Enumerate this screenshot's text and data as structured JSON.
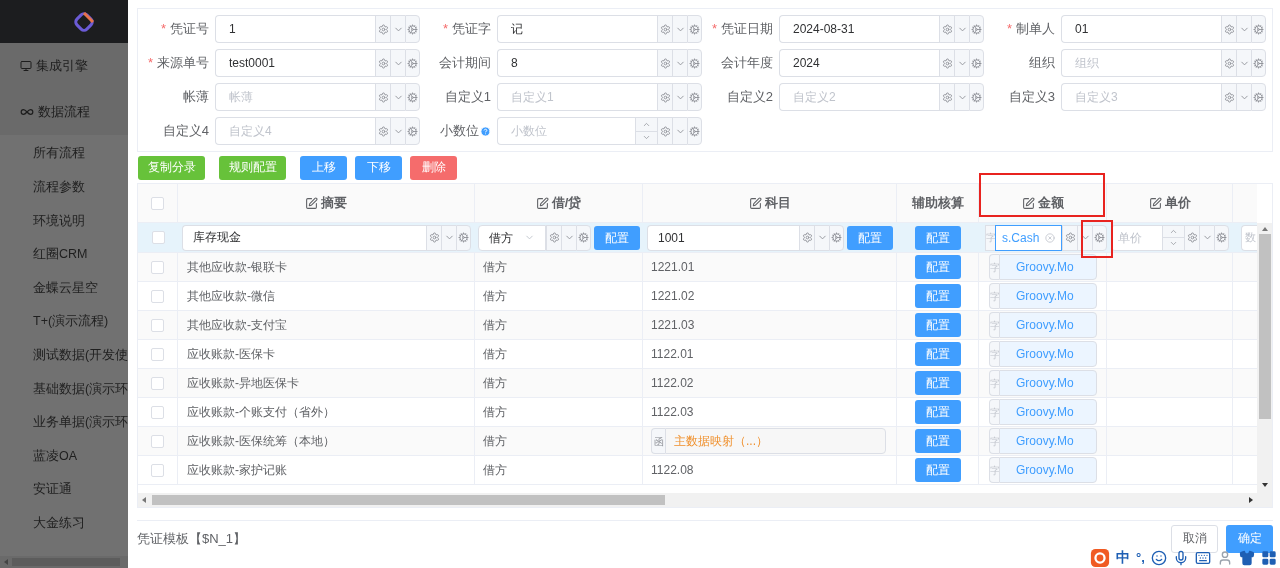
{
  "sidebar": {
    "sections": [
      {
        "label": "集成引擎",
        "kind": "engine"
      },
      {
        "label": "数据流程",
        "kind": "flow"
      }
    ],
    "items": [
      "所有流程",
      "流程参数",
      "环境说明",
      "红圈CRM",
      "金蝶云星空",
      "T+(演示流程)",
      "测试数据(开发使",
      "基础数据(演示环",
      "业务单据(演示环",
      "蓝凌OA",
      "安证通",
      "大金练习"
    ]
  },
  "form": {
    "fields": [
      {
        "mark": "*",
        "label": "凭证号",
        "value": "1",
        "kind": "text"
      },
      {
        "mark": "*",
        "label": "凭证字",
        "value": "记",
        "kind": "text"
      },
      {
        "mark": "*",
        "label": "凭证日期",
        "value": "2024-08-31",
        "kind": "text"
      },
      {
        "mark": "*",
        "label": "制单人",
        "value": "01",
        "kind": "text"
      },
      {
        "mark": "*",
        "label": "来源单号",
        "value": "test0001",
        "kind": "text"
      },
      {
        "label": "会计期间",
        "value": "8",
        "kind": "text"
      },
      {
        "label": "会计年度",
        "value": "2024",
        "kind": "text"
      },
      {
        "label": "组织",
        "placeholder": "组织",
        "kind": "text"
      },
      {
        "label": "帐薄",
        "placeholder": "帐薄",
        "kind": "text"
      },
      {
        "label": "自定义1",
        "placeholder": "自定义1",
        "kind": "text"
      },
      {
        "label": "自定义2",
        "placeholder": "自定义2",
        "kind": "text"
      },
      {
        "label": "自定义3",
        "placeholder": "自定义3",
        "kind": "text"
      },
      {
        "label": "自定义4",
        "placeholder": "自定义4",
        "kind": "text"
      },
      {
        "label": "小数位",
        "placeholder": "小数位",
        "kind": "number",
        "help": true
      }
    ]
  },
  "toolbar": [
    {
      "label": "复制分录",
      "kind": "success"
    },
    {
      "label": "规则配置",
      "kind": "success"
    },
    {
      "label": "上移",
      "kind": "primary"
    },
    {
      "label": "下移",
      "kind": "primary"
    },
    {
      "label": "删除",
      "kind": "danger"
    }
  ],
  "table": {
    "all_checked": false,
    "columns": [
      {
        "label": "摘要",
        "editable": true
      },
      {
        "label": "借/贷",
        "editable": true
      },
      {
        "label": "科目",
        "editable": true
      },
      {
        "label": "辅助核算",
        "editable": false
      },
      {
        "label": "金额",
        "editable": true
      },
      {
        "label": "单价",
        "editable": true
      }
    ],
    "edit_row": {
      "checked": false,
      "summary": "库存现金",
      "direction": "借方",
      "direction_config": "配置",
      "subject": "1001",
      "subject_config": "配置",
      "aux": "配置",
      "amount_prefix": "字",
      "amount": "s.Cash",
      "price_placeholder": "单价",
      "next_placeholder": "数"
    },
    "rows": [
      {
        "checked": false,
        "summary": "其他应收款-银联卡",
        "direction": "借方",
        "subject": {
          "kind": "code",
          "text": "1221.01"
        },
        "aux": "配置",
        "amount_prefix": "字",
        "amount": "Groovy.Mo"
      },
      {
        "checked": false,
        "summary": "其他应收款-微信",
        "direction": "借方",
        "subject": {
          "kind": "code",
          "text": "1221.02"
        },
        "aux": "配置",
        "amount_prefix": "字",
        "amount": "Groovy.Mo"
      },
      {
        "checked": false,
        "summary": "其他应收款-支付宝",
        "direction": "借方",
        "subject": {
          "kind": "code",
          "text": "1221.03"
        },
        "aux": "配置",
        "amount_prefix": "字",
        "amount": "Groovy.Mo"
      },
      {
        "checked": false,
        "summary": "应收账款-医保卡",
        "direction": "借方",
        "subject": {
          "kind": "code",
          "text": "1122.01"
        },
        "aux": "配置",
        "amount_prefix": "字",
        "amount": "Groovy.Mo"
      },
      {
        "checked": false,
        "summary": "应收账款-异地医保卡",
        "direction": "借方",
        "subject": {
          "kind": "code",
          "text": "1122.02"
        },
        "aux": "配置",
        "amount_prefix": "字",
        "amount": "Groovy.Mo"
      },
      {
        "checked": false,
        "summary": "应收账款-个账支付（省外）",
        "direction": "借方",
        "subject": {
          "kind": "code",
          "text": "1122.03"
        },
        "aux": "配置",
        "amount_prefix": "字",
        "amount": "Groovy.Mo"
      },
      {
        "checked": false,
        "summary": "应收账款-医保统筹（本地）",
        "direction": "借方",
        "subject": {
          "kind": "mapping",
          "prefix": "函",
          "text": "主数据映射（...）"
        },
        "aux": "配置",
        "amount_prefix": "字",
        "amount": "Groovy.Mo"
      },
      {
        "checked": false,
        "summary": "应收账款-家护记账",
        "direction": "借方",
        "subject": {
          "kind": "code",
          "text": "1122.08"
        },
        "aux": "配置",
        "amount_prefix": "字",
        "amount": "Groovy.Mo"
      }
    ]
  },
  "footer": {
    "template": "凭证模板【$N_1】",
    "buttons": [
      {
        "label": "取消",
        "kind": "default"
      },
      {
        "label": "确定",
        "kind": "primary"
      }
    ]
  },
  "ime_bar": {
    "mode": "中",
    "punctuation": "°,"
  }
}
